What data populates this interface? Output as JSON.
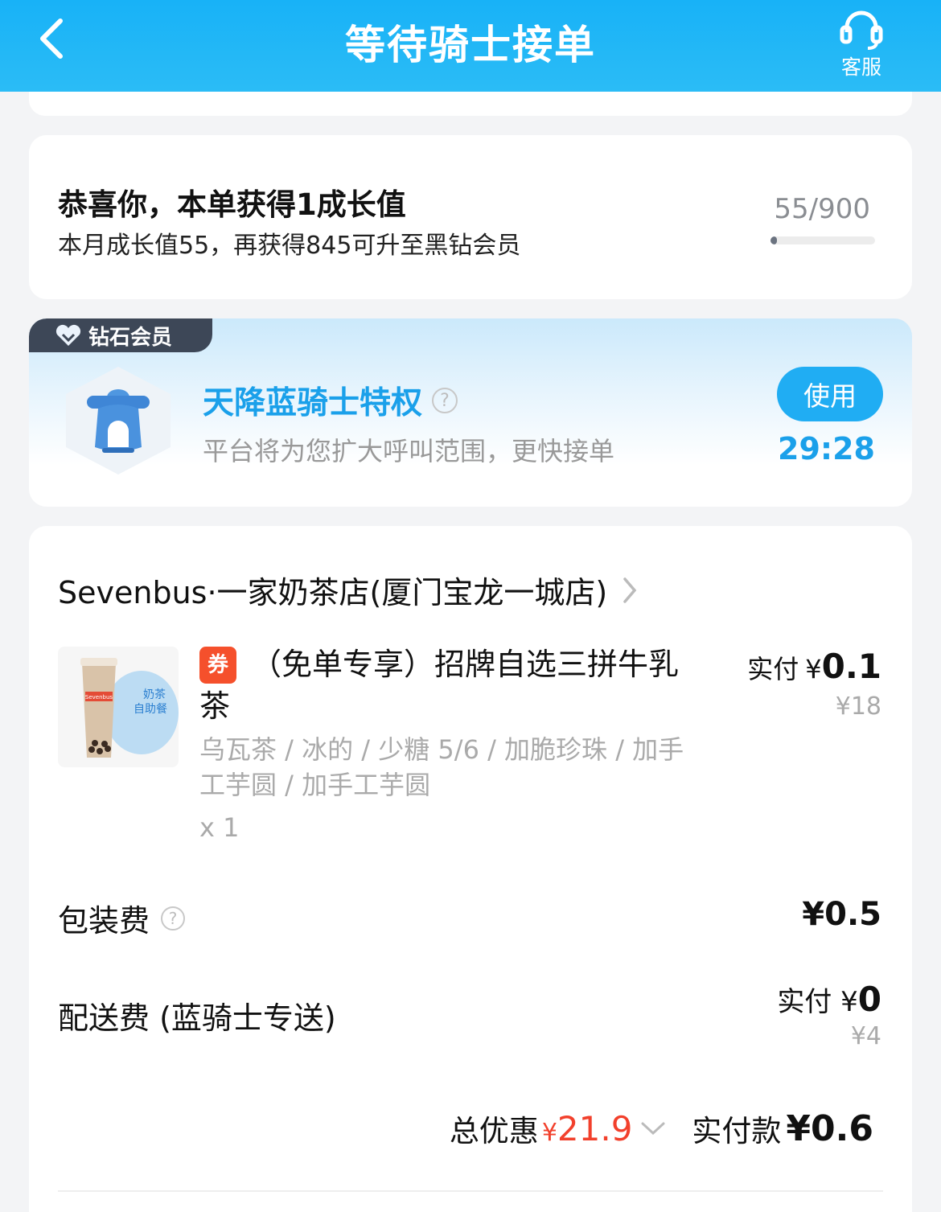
{
  "header": {
    "title": "等待骑士接单",
    "service_label": "客服",
    "bg_color": "#18b2f7"
  },
  "growth": {
    "title": "恭喜你，本单获得1成长值",
    "subtitle": "本月成长值55，再获得845可升至黑钻会员",
    "ratio": "55/900",
    "progress": 0.061
  },
  "privilege": {
    "badge": "钻石会员",
    "title": "天降蓝骑士特权",
    "help": "?",
    "desc": "平台将为您扩大呼叫范围，更快接单",
    "button": "使用",
    "countdown": "29:28",
    "accent_color": "#1aa0ea"
  },
  "order": {
    "shop_name": "Sevenbus·一家奶茶店(厦门宝龙一城店)",
    "item": {
      "coupon_tag": "券",
      "name": "（免单专享）招牌自选三拼牛乳茶",
      "spec": "乌瓦茶 / 冰的 / 少糖 5/6 / 加脆珍珠 / 加手工芋圆 / 加手工芋圆",
      "qty": "x 1",
      "paid_label": "实付",
      "paid_currency": "¥",
      "paid_value": "0.1",
      "original_price": "¥18",
      "image_brand": "Sevenbus",
      "image_caption_1": "奶茶",
      "image_caption_2": "自助餐"
    },
    "packing": {
      "label": "包装费",
      "help": "?",
      "amount": "¥0.5"
    },
    "delivery": {
      "label": "配送费 (蓝骑士专送)",
      "paid_label": "实付",
      "paid_currency": "¥",
      "paid_value": "0",
      "original": "¥4"
    },
    "summary": {
      "discount_label": "总优惠",
      "discount_currency": "¥",
      "discount_value": "21.9",
      "paid_label": "实付款",
      "paid_currency": "¥",
      "paid_value": "0.6",
      "discount_color": "#f2402c"
    }
  }
}
